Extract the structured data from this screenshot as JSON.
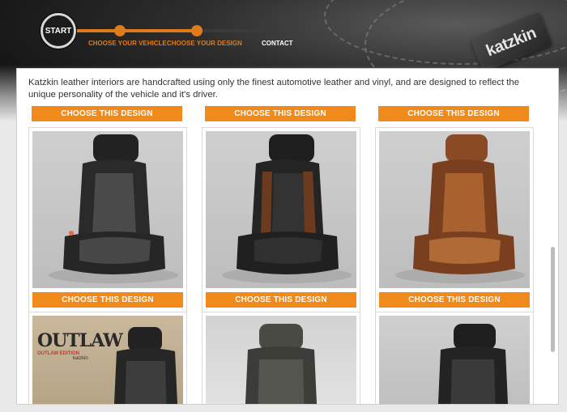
{
  "header": {
    "brand_logo_text": "katzkin",
    "start_label": "START",
    "steps": [
      {
        "label": "CHOOSE YOUR VEHICLE"
      },
      {
        "label": "CHOOSE YOUR DESIGN"
      },
      {
        "label": "CONTACT"
      }
    ]
  },
  "main": {
    "intro": "Katzkin leather interiors are handcrafted using only the finest automotive leather and vinyl, and are designed to reflect the unique personality of the vehicle and it's driver.",
    "choose_label": "CHOOSE THIS DESIGN",
    "designs": [
      {
        "name": "black-grey"
      },
      {
        "name": "black-brown"
      },
      {
        "name": "brown"
      },
      {
        "name": "outlaw",
        "logo_text": "OUTLAW",
        "logo_sub": "OUTLAW EDITION",
        "logo_brand": "katzkin"
      },
      {
        "name": "dark-grey"
      },
      {
        "name": "black-charcoal"
      }
    ]
  },
  "colors": {
    "accent": "#f08a1c",
    "step_orange": "#e07b1a",
    "header_dark": "#161616"
  }
}
